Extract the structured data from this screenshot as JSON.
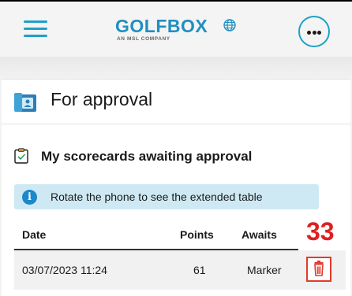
{
  "header": {
    "logo_text": "GOLFBOX",
    "logo_sub": "AN MSL COMPANY",
    "menu_icon": "hamburger-menu-icon",
    "more_icon": "ellipsis-icon",
    "accent_color": "#1ea0c8"
  },
  "page": {
    "title": "For approval",
    "title_icon": "wallet-icon"
  },
  "section": {
    "title": "My scorecards awaiting approval",
    "icon": "clipboard-check-icon"
  },
  "info": {
    "text": "Rotate the phone to see the extended table",
    "icon": "info-icon"
  },
  "table": {
    "columns": [
      "Date",
      "Points",
      "Awaits"
    ],
    "rows": [
      {
        "date": "03/07/2023 11:24",
        "points": "61",
        "awaits": "Marker",
        "action_icon": "trash-icon"
      }
    ]
  },
  "annotation": {
    "label": "33",
    "color": "#e02020"
  }
}
